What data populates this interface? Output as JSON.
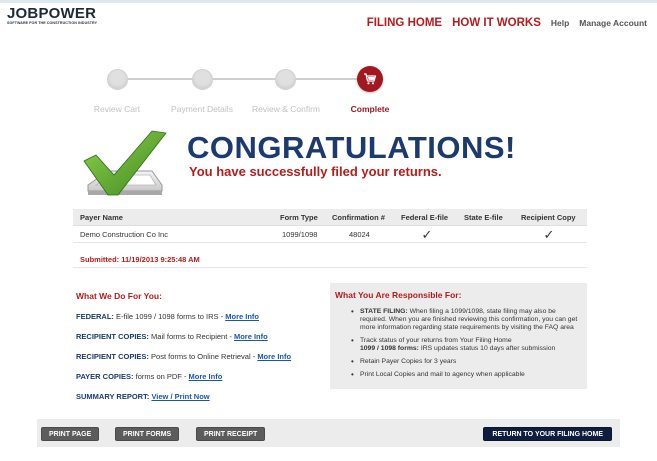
{
  "logo": {
    "name": "JOBPOWER",
    "tagline": "SOFTWARE FOR THE CONSTRUCTION INDUSTRY"
  },
  "nav": {
    "filing_home": "FILING HOME",
    "how_it_works": "HOW IT WORKS",
    "help": "Help",
    "manage_account": "Manage Account"
  },
  "steps": {
    "step1": "Review Cart",
    "step2": "Payment Details",
    "step3": "Review & Confirm",
    "step4": "Complete",
    "current": 4
  },
  "congrats": {
    "title": "CONGRATULATIONS!",
    "subtitle": "You have successfully filed your returns."
  },
  "table": {
    "headers": {
      "payer_name": "Payer Name",
      "form_type": "Form Type",
      "confirmation": "Confirmation #",
      "federal": "Federal E-file",
      "state": "State E-file",
      "recipient": "Recipient Copy"
    },
    "row": {
      "payer_name": "Demo Construction Co Inc",
      "form_type": "1099/1098",
      "confirmation": "48024",
      "federal": "✓",
      "state": "",
      "recipient": "✓"
    },
    "submitted": "Submitted: 11/19/2013 9:25:48 AM"
  },
  "what_we_do": {
    "heading": "What We Do For You:",
    "federal_label": "FEDERAL:",
    "federal_text": " E-file 1099 / 1098 forms to IRS - ",
    "recipient_mail_label": "RECIPIENT COPIES:",
    "recipient_mail_text": " Mail forms to Recipient - ",
    "recipient_online_label": "RECIPIENT COPIES:",
    "recipient_online_text": " Post forms to Online Retrieval - ",
    "payer_label": "PAYER COPIES:",
    "payer_text": " forms on PDF - ",
    "summary_label": "SUMMARY REPORT:",
    "more_info": "More Info",
    "view_print": "View / Print Now"
  },
  "responsible": {
    "heading": "What You Are Responsible For:",
    "item1_label": "STATE FILING:",
    "item1_text": " When filing a 1099/1098, state filing may also be required. When you are finished reviewing this confirmation, you can get more information regarding state requirements by visiting the FAQ area",
    "item2_text": "Track status of your returns from Your Filing Home",
    "item2_label": "1099 / 1098 forms:",
    "item2_text2": " IRS updates status 10 days after submission",
    "item3_text": "Retain Payer Copies for 3 years",
    "item4_text": "Print Local Copies and mail to agency when applicable"
  },
  "footer": {
    "print_page": "PRINT PAGE",
    "print_forms": "PRINT FORMS",
    "print_receipt": "PRINT RECEIPT",
    "return_home": "RETURN TO YOUR FILING HOME"
  },
  "colors": {
    "brand_red": "#b71c1c",
    "title_navy": "#1d3a6e",
    "link_blue": "#1a56b0",
    "check_green": "#5aa02c",
    "button_dark": "#0f1e3f"
  }
}
